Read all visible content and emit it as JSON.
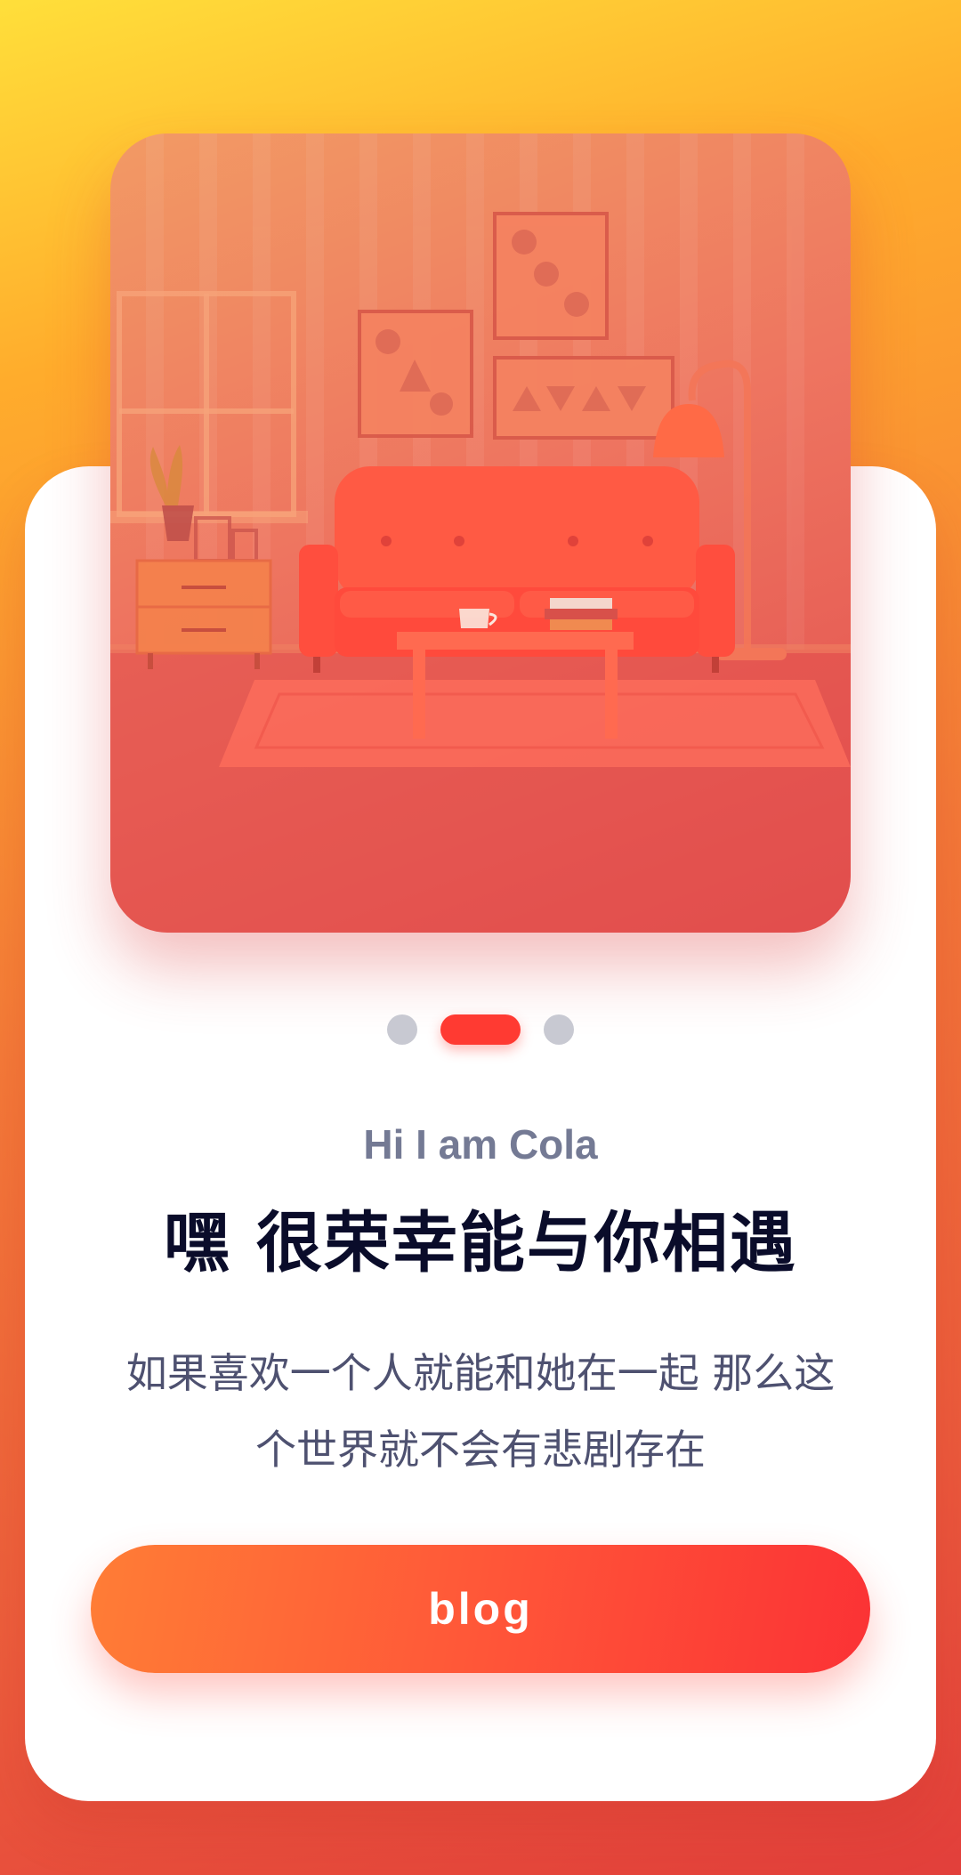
{
  "colors": {
    "background_top": "#ffdf3a",
    "background_bottom": "#e23f3b",
    "accent": "#ff3a32",
    "title": "#0a0c2a",
    "subtitle": "#747a94",
    "description": "#4e5170"
  },
  "hero": {
    "illustration": "living-room-illustration"
  },
  "pager": {
    "count": 3,
    "active_index": 1
  },
  "content": {
    "subtitle": "Hi I am Cola",
    "title": "嘿 很荣幸能与你相遇",
    "description": "如果喜欢一个人就能和她在一起 那么这个世界就不会有悲剧存在"
  },
  "actions": {
    "blog_label": "blog"
  }
}
